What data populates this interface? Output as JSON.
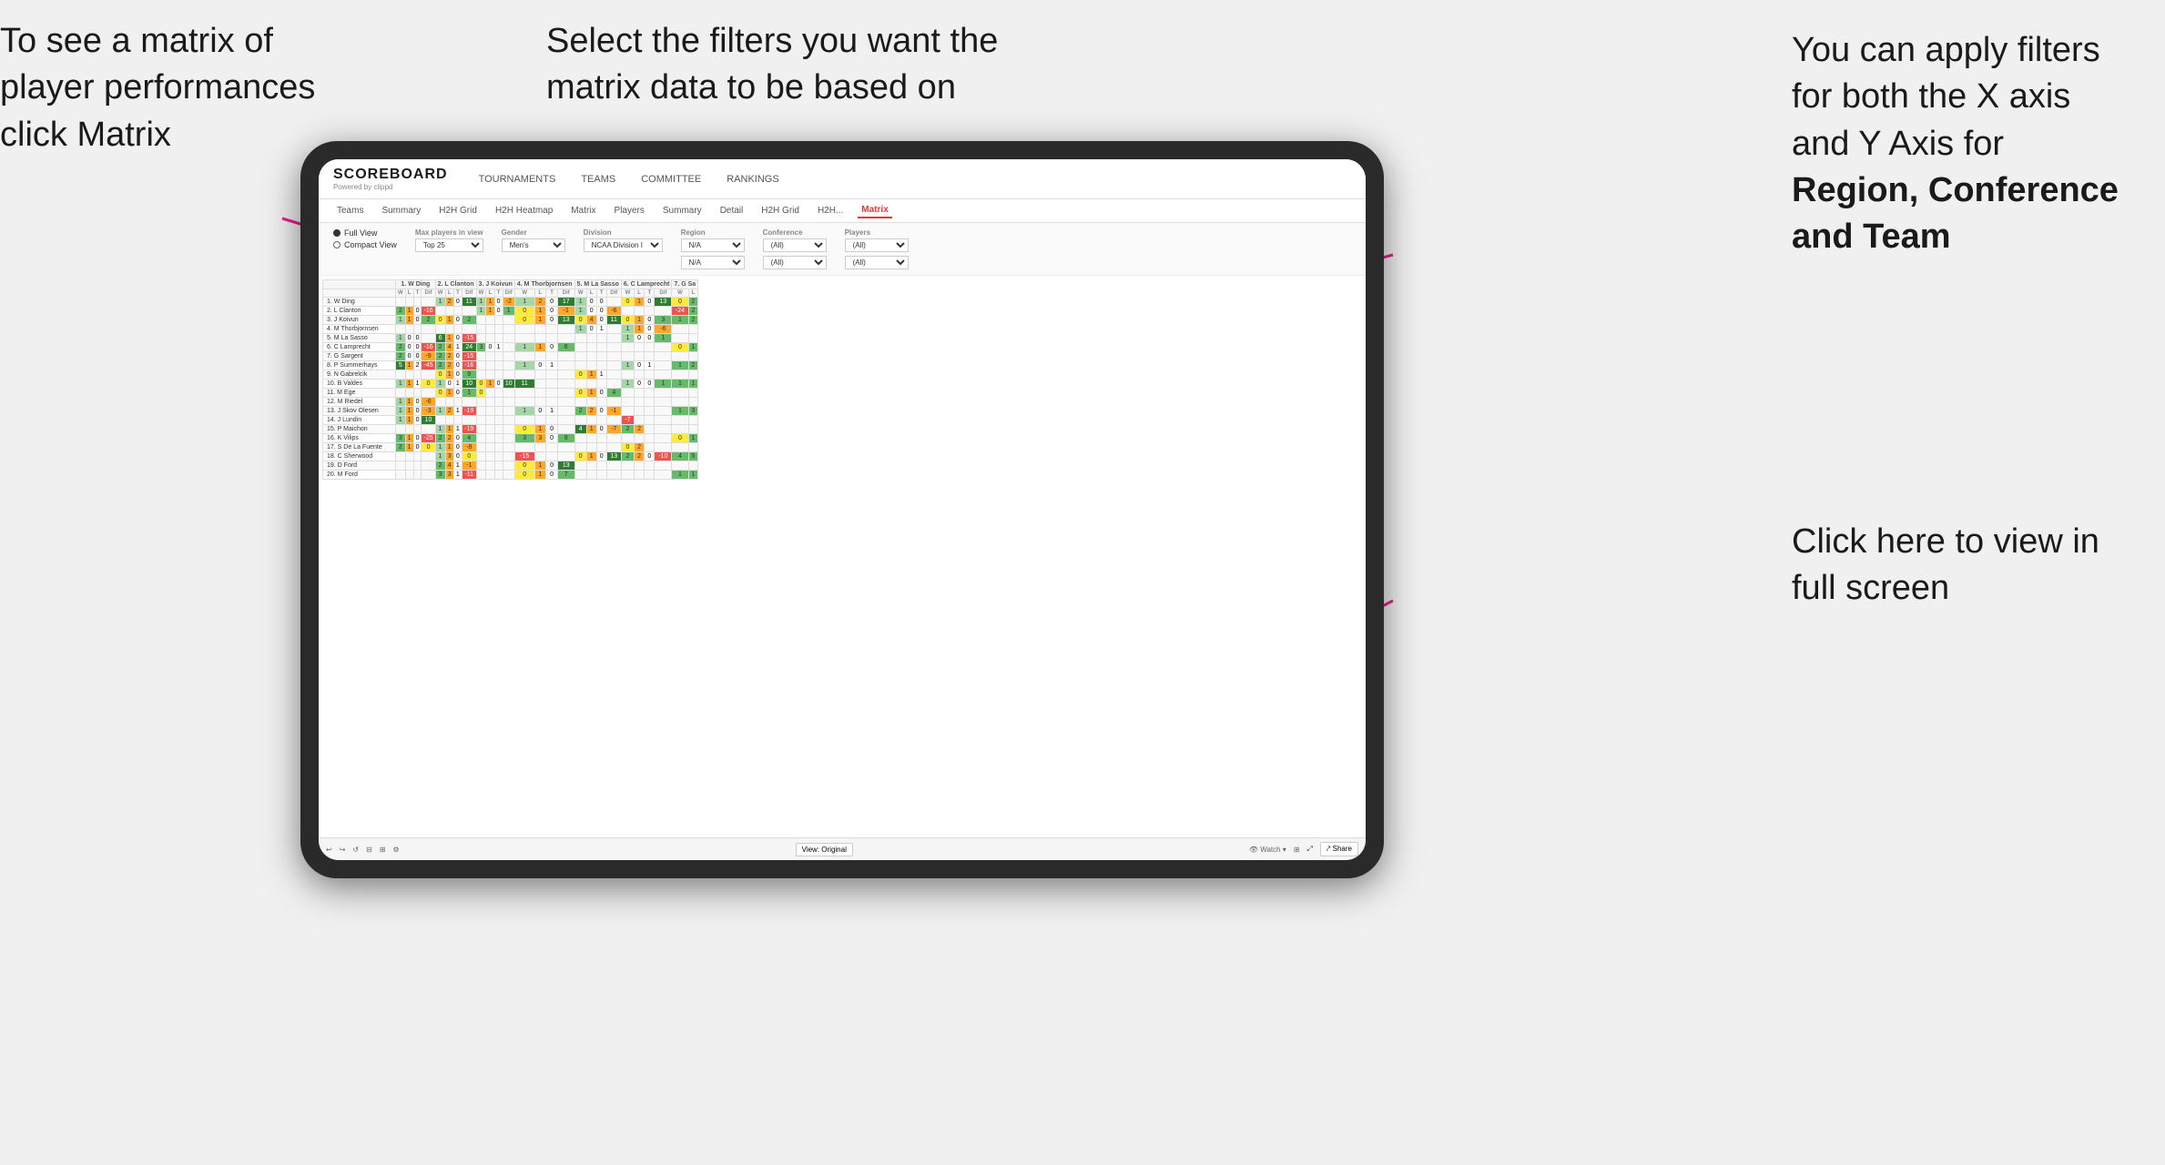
{
  "annotations": {
    "left_top": "To see a matrix of player performances click Matrix",
    "left_top_bold": "Matrix",
    "center_top": "Select the filters you want the matrix data to be based on",
    "right_top": "You  can apply filters for both the X axis and Y Axis for Region, Conference and Team",
    "right_top_bold_parts": [
      "Region,",
      "Conference and",
      "Team"
    ],
    "right_bottom": "Click here to view in full screen"
  },
  "app": {
    "logo": "SCOREBOARD",
    "logo_sub": "Powered by clippd",
    "nav": [
      "TOURNAMENTS",
      "TEAMS",
      "COMMITTEE",
      "RANKINGS"
    ],
    "sub_nav": [
      "Teams",
      "Summary",
      "H2H Grid",
      "H2H Heatmap",
      "Matrix",
      "Players",
      "Summary",
      "Detail",
      "H2H Grid",
      "H2H...",
      "Matrix"
    ],
    "active_tab": "Matrix"
  },
  "filters": {
    "view_options": [
      "Full View",
      "Compact View"
    ],
    "active_view": "Full View",
    "max_players_label": "Max players in view",
    "max_players_value": "Top 25",
    "gender_label": "Gender",
    "gender_value": "Men's",
    "division_label": "Division",
    "division_value": "NCAA Division I",
    "region_label": "Region",
    "region_value": "N/A",
    "region_value2": "N/A",
    "conference_label": "Conference",
    "conference_value": "(All)",
    "conference_value2": "(All)",
    "players_label": "Players",
    "players_value": "(All)",
    "players_value2": "(All)"
  },
  "matrix": {
    "col_headers": [
      "1. W Ding",
      "2. L Clanton",
      "3. J Koivun",
      "4. M Thorbjornsen",
      "5. M La Sasso",
      "6. C Lamprecht",
      "7. G Sa"
    ],
    "sub_headers": [
      "W",
      "L",
      "T",
      "Dif"
    ],
    "rows": [
      {
        "name": "1. W Ding",
        "cells": [
          "",
          "",
          "",
          "",
          "1",
          "2",
          "0",
          "11",
          "1",
          "1",
          "0",
          "-2",
          "1",
          "2",
          "0",
          "17",
          "1",
          "0",
          "0",
          "",
          "0",
          "1",
          "0",
          "13",
          "0",
          "2"
        ]
      },
      {
        "name": "2. L Clanton",
        "cells": [
          "2",
          "1",
          "0",
          "-16",
          "",
          "",
          "",
          "",
          "1",
          "1",
          "0",
          "1",
          "0",
          "1",
          "0",
          "-1",
          "1",
          "0",
          "0",
          "-6",
          "",
          "",
          "",
          "",
          "-24",
          "2",
          "2"
        ]
      },
      {
        "name": "3. J Koivun",
        "cells": [
          "1",
          "1",
          "0",
          "2",
          "0",
          "1",
          "0",
          "2",
          "",
          "",
          "",
          "",
          "0",
          "1",
          "0",
          "13",
          "0",
          "4",
          "0",
          "11",
          "0",
          "1",
          "0",
          "3",
          "1",
          "2"
        ]
      },
      {
        "name": "4. M Thorbjornsen",
        "cells": [
          "",
          "",
          "",
          "",
          "",
          "",
          "",
          "",
          "",
          "",
          "",
          "",
          "",
          "",
          "",
          "",
          "1",
          "0",
          "1",
          "",
          "1",
          "1",
          "0",
          "-6",
          "",
          ""
        ]
      },
      {
        "name": "5. M La Sasso",
        "cells": [
          "1",
          "0",
          "0",
          "",
          "6",
          "1",
          "0",
          "-15",
          "",
          "",
          "",
          "",
          "",
          "",
          "",
          "",
          "",
          "",
          "",
          "",
          "1",
          "0",
          "0",
          "1",
          "",
          ""
        ]
      },
      {
        "name": "6. C Lamprecht",
        "cells": [
          "2",
          "0",
          "0",
          "-16",
          "2",
          "4",
          "1",
          "24",
          "3",
          "0",
          "1",
          "",
          "1",
          "1",
          "0",
          "6",
          "",
          "",
          "",
          "",
          "",
          "",
          "",
          "",
          "0",
          "1"
        ]
      },
      {
        "name": "7. G Sargent",
        "cells": [
          "2",
          "0",
          "0",
          "-9",
          "2",
          "2",
          "0",
          "-15",
          "",
          "",
          "",
          "",
          "",
          "",
          "",
          "",
          "",
          "",
          "",
          "",
          "",
          "",
          "",
          "",
          "",
          ""
        ]
      },
      {
        "name": "8. P Summerhays",
        "cells": [
          "5",
          "1",
          "2",
          "-45",
          "2",
          "2",
          "0",
          "-16",
          "",
          "",
          "",
          "",
          "1",
          "0",
          "1",
          "",
          "",
          "",
          "",
          "",
          "1",
          "0",
          "1",
          "",
          "1",
          "2"
        ]
      },
      {
        "name": "9. N Gabrelcik",
        "cells": [
          "",
          "",
          "",
          "",
          "0",
          "1",
          "0",
          "9",
          "",
          "",
          "",
          "",
          "",
          "",
          "",
          "",
          "0",
          "1",
          "1",
          "",
          "",
          "",
          "",
          "",
          "",
          ""
        ]
      },
      {
        "name": "10. B Valdes",
        "cells": [
          "1",
          "1",
          "1",
          "0",
          "1",
          "0",
          "1",
          "10",
          "0",
          "1",
          "0",
          "10",
          "11",
          "",
          "",
          "",
          "",
          "",
          "",
          "",
          "1",
          "0",
          "0",
          "1",
          "1",
          "1"
        ]
      },
      {
        "name": "11. M Ege",
        "cells": [
          "",
          "",
          "",
          "",
          "0",
          "1",
          "0",
          "1",
          "0",
          "",
          "",
          "",
          "",
          "",
          "",
          "",
          "0",
          "1",
          "0",
          "4",
          "",
          ""
        ]
      },
      {
        "name": "12. M Riedel",
        "cells": [
          "1",
          "1",
          "0",
          "-6",
          "",
          "",
          "",
          "",
          "",
          "",
          "",
          "",
          "",
          "",
          "",
          "",
          "",
          "",
          "",
          "",
          "",
          ""
        ]
      },
      {
        "name": "13. J Skov Olesen",
        "cells": [
          "1",
          "1",
          "0",
          "-3",
          "1",
          "2",
          "1",
          "-19",
          "",
          "",
          "",
          "",
          "1",
          "0",
          "1",
          "",
          "2",
          "2",
          "0",
          "-1",
          "",
          "",
          "",
          "",
          "1",
          "3"
        ]
      },
      {
        "name": "14. J Lundin",
        "cells": [
          "1",
          "1",
          "0",
          "10",
          "",
          "",
          "",
          "",
          "",
          "",
          "",
          "",
          "",
          "",
          "",
          "",
          "",
          "",
          "",
          "",
          "-7",
          "",
          ""
        ]
      },
      {
        "name": "15. P Maichon",
        "cells": [
          "",
          "",
          "",
          "",
          "1",
          "1",
          "1",
          "-19",
          "",
          "",
          "",
          "",
          "0",
          "1",
          "0",
          "",
          "4",
          "1",
          "0",
          "-7",
          "2",
          "2"
        ]
      },
      {
        "name": "16. K Vilips",
        "cells": [
          "3",
          "1",
          "0",
          "-25",
          "2",
          "2",
          "0",
          "4",
          "",
          "",
          "",
          "",
          "3",
          "3",
          "0",
          "8",
          "",
          "",
          "",
          "",
          "",
          "",
          "",
          "",
          "0",
          "1"
        ]
      },
      {
        "name": "17. S De La Fuente",
        "cells": [
          "2",
          "1",
          "0",
          "0",
          "1",
          "1",
          "0",
          "-8",
          "",
          "",
          "",
          "",
          "",
          "",
          "",
          "",
          "",
          "",
          "",
          "",
          "0",
          "2"
        ]
      },
      {
        "name": "18. C Sherwood",
        "cells": [
          "",
          "",
          "",
          "",
          "1",
          "3",
          "0",
          "0",
          "",
          "",
          "",
          "",
          "-15",
          "",
          "",
          "",
          "0",
          "1",
          "0",
          "13",
          "2",
          "2",
          "0",
          "-10",
          "4",
          "5"
        ]
      },
      {
        "name": "19. D Ford",
        "cells": [
          "",
          "",
          "",
          "",
          "2",
          "4",
          "1",
          "-1",
          "",
          "",
          "",
          "",
          "0",
          "1",
          "0",
          "13",
          "",
          "",
          "",
          "",
          "",
          ""
        ]
      },
      {
        "name": "20. M Ford",
        "cells": [
          "",
          "",
          "",
          "",
          "3",
          "3",
          "1",
          "-11",
          "",
          "",
          "",
          "",
          "0",
          "1",
          "0",
          "7",
          "",
          "",
          "",
          "",
          "",
          "",
          "",
          "",
          "1",
          "1"
        ]
      }
    ]
  },
  "toolbar": {
    "undo": "↩",
    "redo": "↪",
    "view_original": "View: Original",
    "watch": "Watch ▾",
    "share": "Share",
    "fullscreen": "⤢"
  }
}
